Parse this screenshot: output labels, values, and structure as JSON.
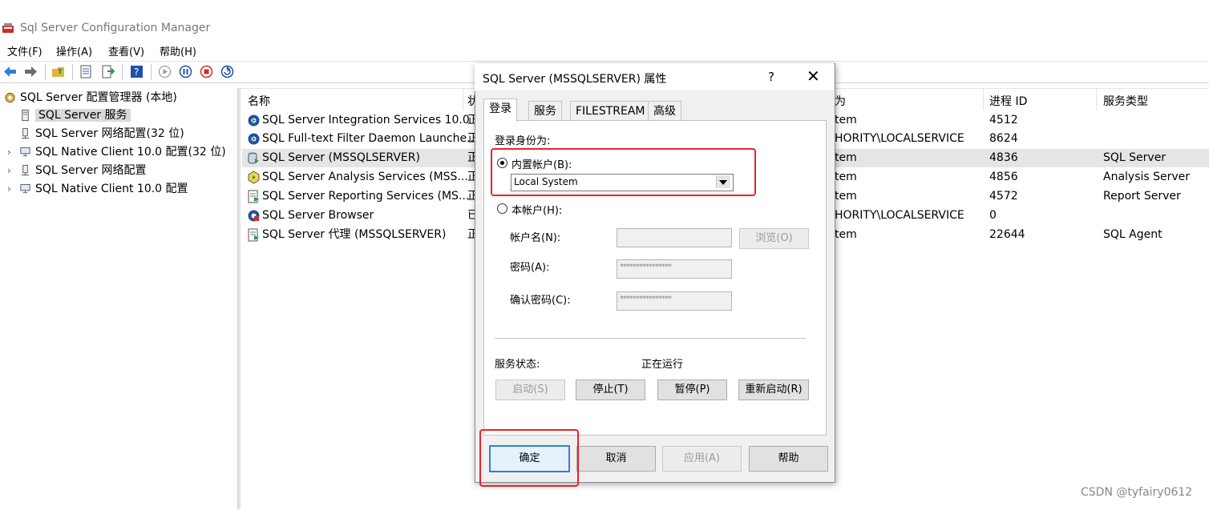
{
  "window": {
    "title": "Sql Server Configuration Manager",
    "menu": [
      "文件(F)",
      "操作(A)",
      "查看(V)",
      "帮助(H)"
    ]
  },
  "tree": {
    "root": "SQL Server 配置管理器 (本地)",
    "items": [
      {
        "label": "SQL Server 服务",
        "selected": true
      },
      {
        "label": "SQL Server 网络配置(32 位)"
      },
      {
        "label": "SQL Native Client 10.0 配置(32 位)"
      },
      {
        "label": "SQL Server 网络配置"
      },
      {
        "label": "SQL Native Client 10.0 配置"
      }
    ]
  },
  "list": {
    "columns": [
      "名称",
      "状",
      "为",
      "进程 ID",
      "服务类型"
    ],
    "rows": [
      {
        "name": "SQL Server Integration Services 10.0",
        "state": "正",
        "logon": "tem",
        "pid": "4512",
        "type": ""
      },
      {
        "name": "SQL Full-text Filter Daemon Launche...",
        "state": "正",
        "logon": "HORITY\\LOCALSERVICE",
        "pid": "8624",
        "type": ""
      },
      {
        "name": "SQL Server (MSSQLSERVER)",
        "state": "正",
        "logon": "tem",
        "pid": "4836",
        "type": "SQL Server"
      },
      {
        "name": "SQL Server Analysis Services (MSS...",
        "state": "正",
        "logon": "tem",
        "pid": "4856",
        "type": "Analysis Server"
      },
      {
        "name": "SQL Server Reporting Services (MS...",
        "state": "正",
        "logon": "tem",
        "pid": "4572",
        "type": "Report Server"
      },
      {
        "name": "SQL Server Browser",
        "state": "已",
        "logon": "HORITY\\LOCALSERVICE",
        "pid": "0",
        "type": ""
      },
      {
        "name": "SQL Server 代理 (MSSQLSERVER)",
        "state": "正",
        "logon": "tem",
        "pid": "22644",
        "type": "SQL Agent"
      }
    ]
  },
  "dialog": {
    "title": "SQL Server (MSSQLSERVER) 属性",
    "help_glyph": "?",
    "close_glyph": "✕",
    "tabs": [
      "登录",
      "服务",
      "FILESTREAM",
      "高级"
    ],
    "logon_as_label": "登录身份为:",
    "builtin_account_label": "内置帐户(B):",
    "builtin_account_value": "Local System",
    "this_account_label": "本帐户(H):",
    "account_name_label": "帐户名(N):",
    "password_label": "密码(A):",
    "confirm_password_label": "确认密码(C):",
    "browse_button": "浏览(O)",
    "password_mask": "****************",
    "service_status_label": "服务状态:",
    "service_status_value": "正在运行",
    "start_button": "启动(S)",
    "stop_button": "停止(T)",
    "pause_button": "暂停(P)",
    "restart_button": "重新启动(R)",
    "ok_button": "确定",
    "cancel_button": "取消",
    "apply_button": "应用(A)",
    "help_button": "帮助"
  },
  "watermark": "CSDN @tyfairy0612"
}
